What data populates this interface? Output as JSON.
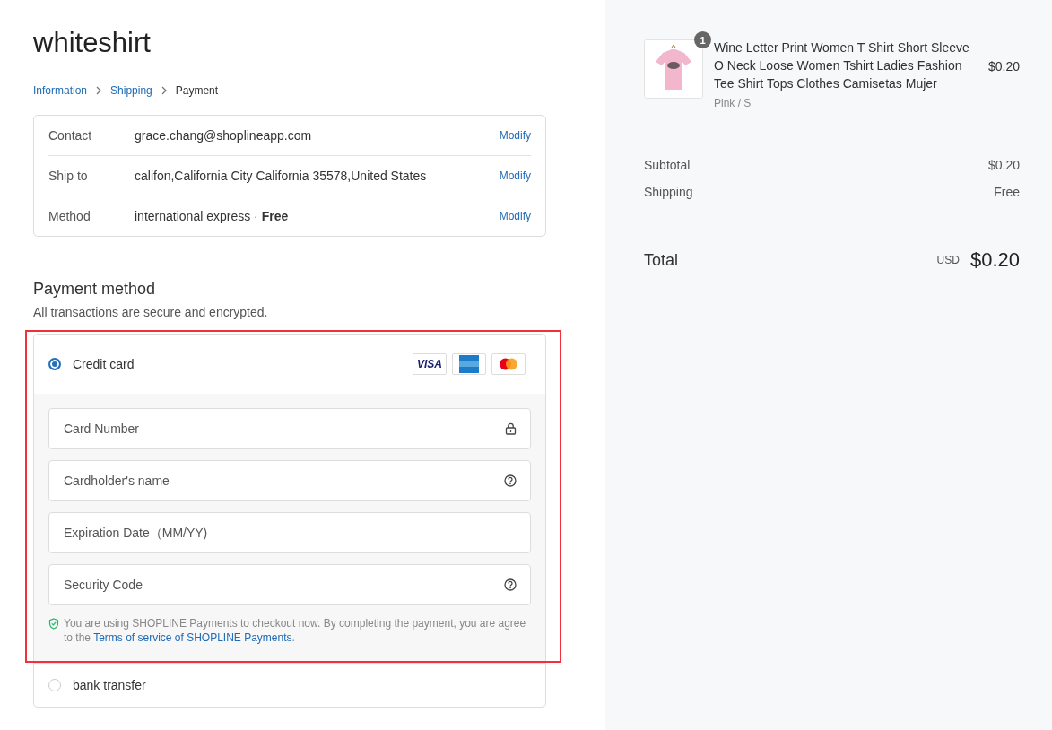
{
  "store": {
    "name": "whiteshirt"
  },
  "breadcrumb": [
    {
      "label": "Information",
      "current": false
    },
    {
      "label": "Shipping",
      "current": false
    },
    {
      "label": "Payment",
      "current": true
    }
  ],
  "review": [
    {
      "label": "Contact",
      "value": "grace.chang@shoplineapp.com",
      "action": "Modify"
    },
    {
      "label": "Ship to",
      "value": "califon,California City California 35578,United States",
      "action": "Modify"
    },
    {
      "label": "Method",
      "value": "international express · **Free**",
      "action": "Modify"
    }
  ],
  "payment": {
    "title": "Payment method",
    "subtitle": "All transactions are secure and encrypted.",
    "methods": [
      {
        "kind": "card",
        "label": "Credit card",
        "selected": true,
        "highlighted": true,
        "brands": [
          {
            "kind": "visa",
            "label": "VISA"
          },
          {
            "kind": "amex"
          },
          {
            "kind": "mastercard"
          }
        ],
        "fields": [
          {
            "placeholder": "Card Number",
            "kind": "lock"
          },
          {
            "placeholder": "Cardholder's name",
            "kind": "help"
          },
          {
            "placeholder": "Expiration Date（MM/YY)",
            "kind": "plain"
          },
          {
            "placeholder": "Security Code",
            "kind": "help"
          }
        ],
        "notice": "You are using SHOPLINE Payments to checkout now. By completing the payment, you are agree to the",
        "notice_link": "Terms of service of SHOPLINE Payments",
        "notice_end": "."
      },
      {
        "kind": "plain",
        "label": "bank transfer",
        "selected": false,
        "highlighted": false
      }
    ]
  },
  "summary": {
    "items": [
      {
        "quantity": "1",
        "title": "Wine Letter Print Women T Shirt Short Sleeve O Neck Loose Women Tshirt Ladies Fashion Tee Shirt Tops Clothes Camisetas Mujer",
        "variant": "Pink / S",
        "price": "$0.20"
      }
    ],
    "lines": [
      {
        "label": "Subtotal",
        "value": "$0.20"
      },
      {
        "label": "Shipping",
        "value": "Free"
      }
    ],
    "total": {
      "label": "Total",
      "currency": "USD",
      "value": "$0.20"
    }
  }
}
